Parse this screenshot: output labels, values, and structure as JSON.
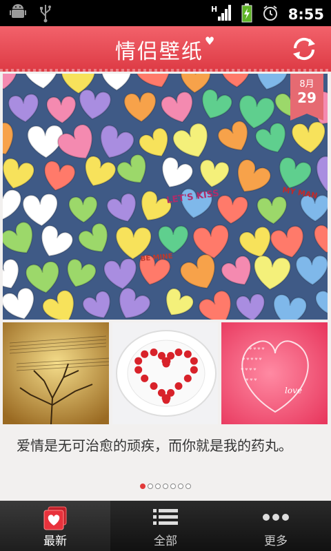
{
  "status_bar": {
    "time": "8:55",
    "network": "H",
    "icons": [
      "android-debug-icon",
      "usb-icon",
      "signal-icon",
      "battery-charging-icon",
      "alarm-icon"
    ]
  },
  "header": {
    "title": "情侣壁纸",
    "refresh_icon": "refresh-icon",
    "accent_color": "#e8464f"
  },
  "featured": {
    "date_month": "8月",
    "date_day": "29",
    "candy_texts": [
      "LET'S KISS",
      "MY MAN",
      "BE MINE"
    ]
  },
  "thumbnails": [
    {
      "name": "vintage-music-tree"
    },
    {
      "name": "strawberry-heart-plate"
    },
    {
      "name": "pink-heart-love",
      "text": "love"
    }
  ],
  "caption": "爱情是无可治愈的顽疾，而你就是我的药丸。",
  "pagination": {
    "count": 7,
    "active": 0
  },
  "bottom_nav": [
    {
      "label": "最新",
      "icon": "heart-pages-icon",
      "active": true
    },
    {
      "label": "全部",
      "icon": "list-icon",
      "active": false
    },
    {
      "label": "更多",
      "icon": "more-dots-icon",
      "active": false
    }
  ]
}
